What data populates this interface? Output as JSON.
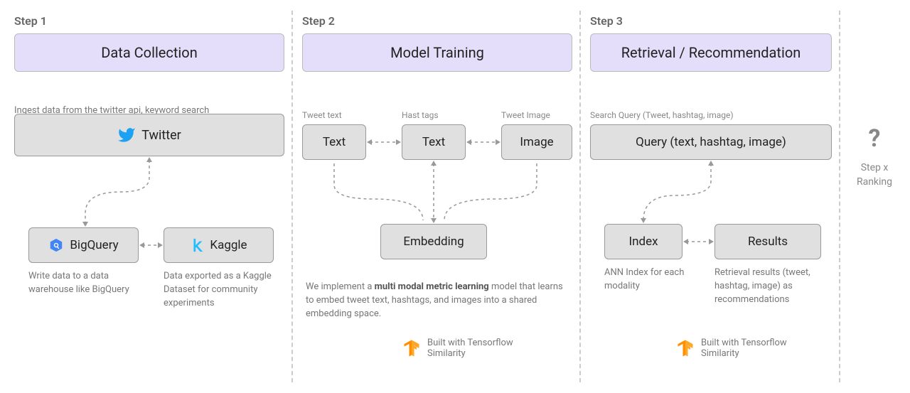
{
  "step1": {
    "label": "Step 1",
    "title": "Data Collection",
    "ingest_desc": "Ingest data from the twitter api, keyword search",
    "twitter": "Twitter",
    "bigquery": "BigQuery",
    "kaggle": "Kaggle",
    "bq_caption": "Write data to a data warehouse like BigQuery",
    "kg_caption": "Data exported as a Kaggle Dataset for community experiments"
  },
  "step2": {
    "label": "Step 2",
    "title": "Model Training",
    "tweet_text_label": "Tweet text",
    "hashtags_label": "Hast tags",
    "tweet_image_label": "Tweet Image",
    "text1": "Text",
    "text2": "Text",
    "image": "Image",
    "embedding": "Embedding",
    "caption_pre": "We implement a ",
    "caption_bold": "multi modal metric learning",
    "caption_post": " model that learns to embed tweet text, hashtags, and  images into a shared embedding space.",
    "tf_badge": "Built with Tensorflow Similarity"
  },
  "step3": {
    "label": "Step 3",
    "title": "Retrieval / Recommendation",
    "query_label": "Search Query (Tweet, hashtag, image)",
    "query": "Query (text, hashtag, image)",
    "index": "Index",
    "results": "Results",
    "idx_caption": "ANN Index for each modality",
    "res_caption": "Retrieval results (tweet, hashtag, image) as recommendations",
    "tf_badge": "Built with Tensorflow Similarity"
  },
  "stepx": {
    "qmark": "?",
    "label": "Step x Ranking"
  }
}
